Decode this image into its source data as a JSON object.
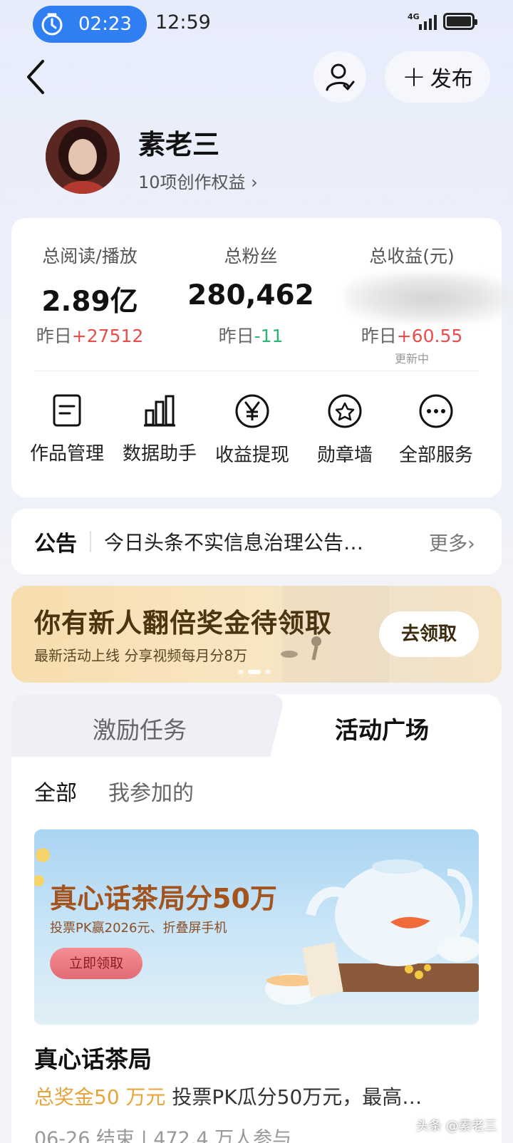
{
  "status_bar": {
    "timer": "02:23",
    "clock": "12:59",
    "network": "4G"
  },
  "header": {
    "publish_label": "发布"
  },
  "profile": {
    "name": "素老三",
    "rights": "10项创作权益 ›"
  },
  "stats": [
    {
      "label": "总阅读/播放",
      "value": "2.89亿",
      "delta_prefix": "昨日",
      "delta": "+27512",
      "trend": "up"
    },
    {
      "label": "总粉丝",
      "value": "280,462",
      "delta_prefix": "昨日",
      "delta": "-11",
      "trend": "down"
    },
    {
      "label": "总收益(元)",
      "value": "",
      "delta_prefix": "昨日",
      "delta": "+60.55",
      "trend": "up",
      "note": "更新中"
    }
  ],
  "tools": [
    {
      "label": "作品管理",
      "icon": "document-icon"
    },
    {
      "label": "数据助手",
      "icon": "bar-chart-icon"
    },
    {
      "label": "收益提现",
      "icon": "yen-icon"
    },
    {
      "label": "勋章墙",
      "icon": "medal-icon"
    },
    {
      "label": "全部服务",
      "icon": "more-icon"
    }
  ],
  "notice": {
    "tag": "公告",
    "text": "今日头条不实信息治理公告…",
    "more": "更多›"
  },
  "promo": {
    "title": "你有新人翻倍奖金待领取",
    "subtitle": "最新活动上线 分享视频每月分8万",
    "button": "去领取"
  },
  "tabs": {
    "incentive": "激励任务",
    "activity": "活动广场",
    "filter_all": "全部",
    "filter_joined": "我参加的"
  },
  "activity": {
    "banner_title": "真心话茶局分50万",
    "banner_sub": "投票PK赢2026元、折叠屏手机",
    "banner_button": "立即领取",
    "title": "真心话茶局",
    "prize": "总奖金50 万元",
    "desc": " 投票PK瓜分50万元，最高…",
    "meta": "06-26 结束 | 472.4 万人参与"
  },
  "watermark": "头条 @素老三",
  "colors": {
    "accent_blue": "#2f7ff3",
    "up_red": "#e94d4d",
    "down_green": "#2bb673",
    "prize_orange": "#e9a33b"
  }
}
